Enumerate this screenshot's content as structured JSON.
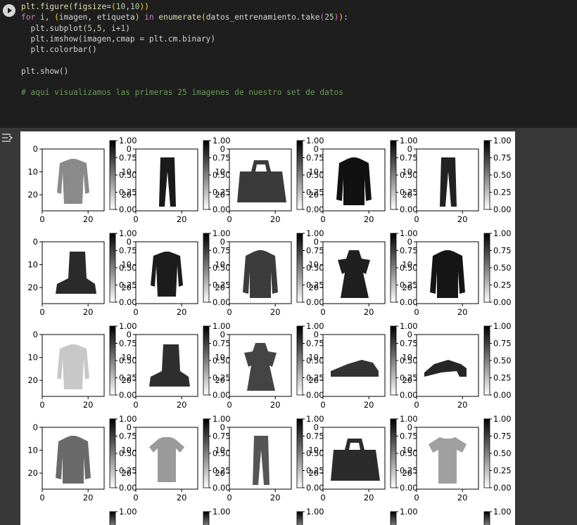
{
  "cell": {
    "run_icon": "play-circle-icon",
    "output_icon": "output-toggle-icon",
    "code": {
      "l1": {
        "a": "plt.figure(figsize=",
        "b": "(",
        "c": "10",
        "d": ",",
        "e": "10",
        "f": ")",
        "g": ")"
      },
      "l2": {
        "a": "for",
        "b": " i, ",
        "c": "(",
        "d": "imagen, etiqueta",
        "e": ")",
        "f": " in ",
        "g": "enumerate",
        "h": "(",
        "i": "datos_entrenamiento.take",
        "j": "(",
        "k": "25",
        "l": ")",
        "m": ")",
        "n": ":"
      },
      "l3": {
        "a": "  plt.subplot(",
        "b": "5",
        "c": ",",
        "d": "5",
        "e": ", i+",
        "f": "1",
        "g": ")"
      },
      "l4": {
        "a": "  plt.imshow(imagen,cmap = plt.cm.binary)"
      },
      "l5": {
        "a": "  plt.colorbar()"
      },
      "l6": {
        "a": "plt.show()"
      },
      "l7": {
        "a": "# aquí visualizamos las primeras 25 imagenes de nuestro set de datos"
      }
    }
  },
  "figure": {
    "image_labels": [
      "pullover",
      "pants",
      "bag",
      "coat",
      "pants",
      "ankle boot",
      "pullover",
      "coat",
      "dress",
      "coat",
      "pullover",
      "ankle boot",
      "dress",
      "sneaker",
      "sandal",
      "coat",
      "shirt",
      "pants",
      "bag",
      "t-shirt"
    ],
    "x_ticks": [
      "0",
      "20"
    ],
    "y_ticks": [
      "0",
      "10",
      "20"
    ],
    "colorbar_ticks": [
      "1.00",
      "0.75",
      "0.50",
      "0.25",
      "0.00"
    ],
    "colorbar_ticks_partial": [
      "1.00"
    ],
    "colors": {
      "colorbar_top": "#000000",
      "colorbar_bottom": "#ffffff"
    }
  },
  "chart_data": {
    "type": "heatmap",
    "subplot_grid": [
      5,
      5
    ],
    "visible_rows": 4,
    "x_ticks": [
      0,
      20
    ],
    "y_ticks": [
      0,
      10,
      20
    ],
    "xlim": [
      0,
      27
    ],
    "ylim": [
      27,
      0
    ],
    "colormap": "binary",
    "colorbar_range": [
      0,
      1
    ],
    "colorbar_ticks": [
      0.0,
      0.25,
      0.5,
      0.75,
      1.0
    ],
    "grid": false
  }
}
